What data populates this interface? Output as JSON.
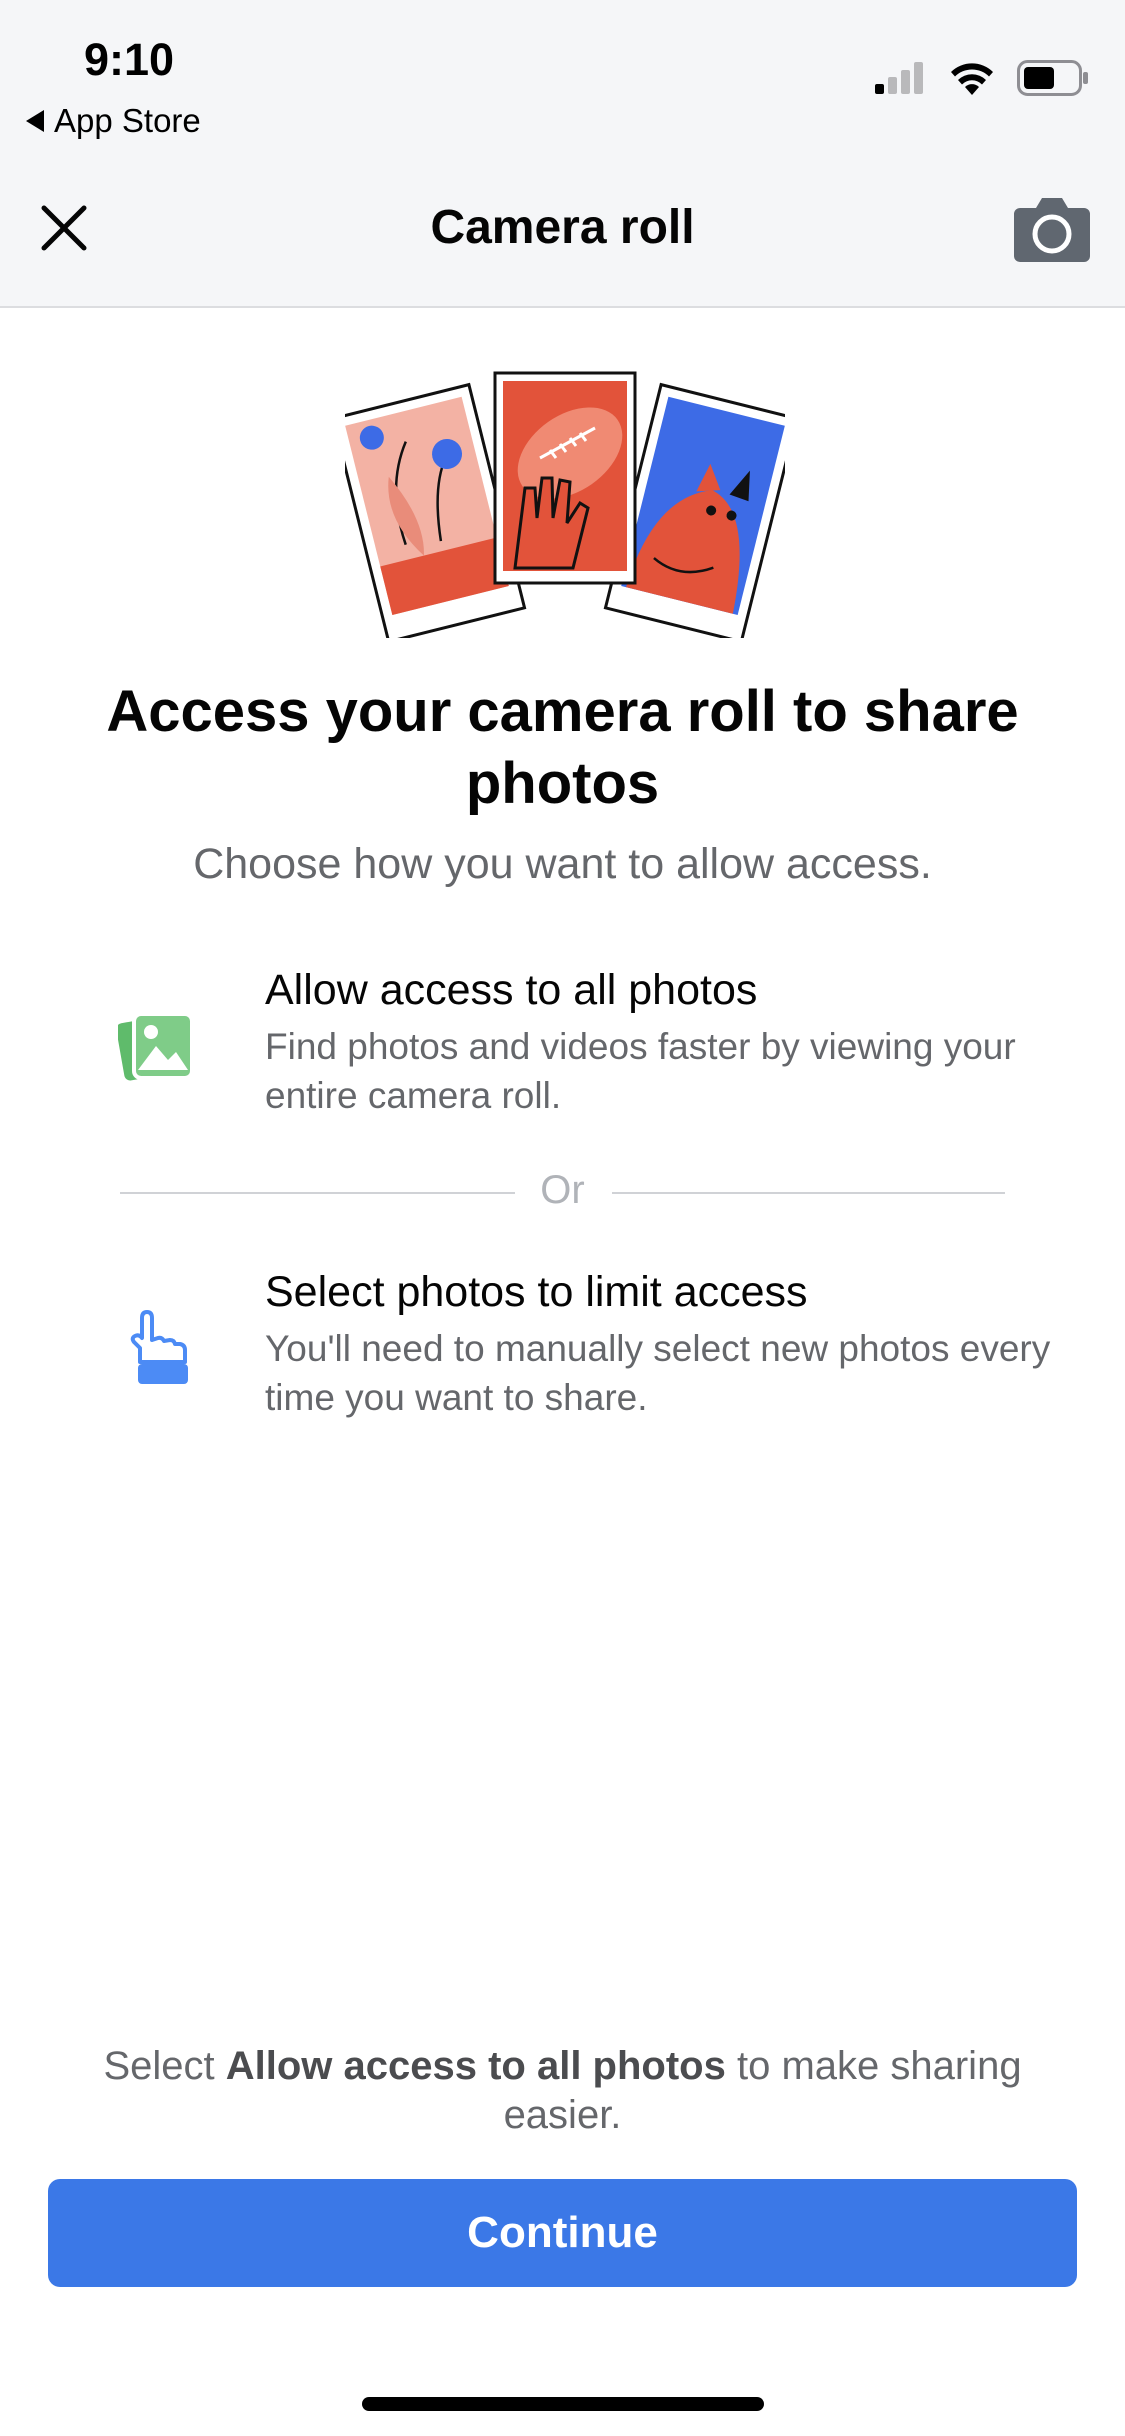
{
  "status_bar": {
    "time": "9:10",
    "back_label": "App Store",
    "icons": [
      "signal-icon",
      "wifi-icon",
      "battery-icon"
    ]
  },
  "nav": {
    "title": "Camera roll",
    "close_icon": "close-icon",
    "camera_icon": "camera-icon"
  },
  "main": {
    "heading": "Access your camera roll to share photos",
    "subtitle": "Choose how you want to allow access.",
    "options": [
      {
        "icon": "photos-icon",
        "title": "Allow access to all photos",
        "description": "Find photos and videos faster by viewing your entire camera roll."
      },
      {
        "icon": "hand-pointer-icon",
        "title": "Select photos to limit access",
        "description": "You'll need to manually select new photos every time you want to share."
      }
    ],
    "divider_label": "Or"
  },
  "footer": {
    "note_prefix": "Select ",
    "note_bold": "Allow access to all photos",
    "note_suffix": " to make sharing easier.",
    "continue_label": "Continue"
  },
  "colors": {
    "accent": "#3b78e7",
    "photos_icon": "#5fbb6b",
    "hand_icon": "#4c8bf5",
    "header_bg": "#f5f6f8",
    "secondary_text": "#65676b"
  }
}
